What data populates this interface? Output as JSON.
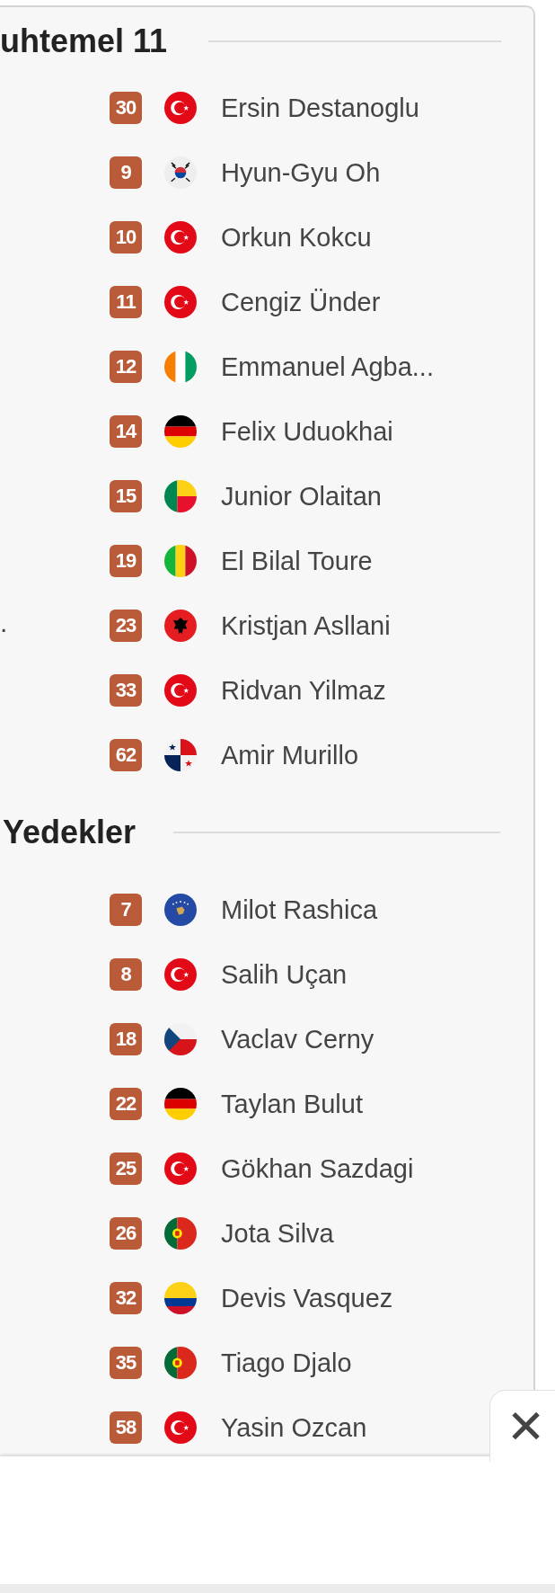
{
  "sections": [
    {
      "title": "uhtemel 11",
      "players": [
        {
          "number": "30",
          "flag": {
            "kind": "tr"
          },
          "name": "Ersin Destanoglu"
        },
        {
          "number": "9",
          "flag": {
            "kind": "kr"
          },
          "name": "Hyun-Gyu Oh"
        },
        {
          "number": "10",
          "flag": {
            "kind": "tr"
          },
          "name": "Orkun Kokcu"
        },
        {
          "number": "11",
          "flag": {
            "kind": "tr"
          },
          "name": "Cengiz Ünder"
        },
        {
          "number": "12",
          "flag": {
            "kind": "ci"
          },
          "name": "Emmanuel Agba..."
        },
        {
          "number": "14",
          "flag": {
            "kind": "de"
          },
          "name": "Felix Uduokhai"
        },
        {
          "number": "15",
          "flag": {
            "kind": "bj"
          },
          "name": "Junior Olaitan"
        },
        {
          "number": "19",
          "flag": {
            "kind": "ml"
          },
          "name": "El Bilal Toure"
        },
        {
          "number": "23",
          "flag": {
            "kind": "al"
          },
          "name": "Kristjan Asllani",
          "left_fragment": "."
        },
        {
          "number": "33",
          "flag": {
            "kind": "tr"
          },
          "name": "Ridvan Yilmaz"
        },
        {
          "number": "62",
          "flag": {
            "kind": "pa"
          },
          "name": "Amir Murillo"
        }
      ]
    },
    {
      "title": "Yedekler",
      "players": [
        {
          "number": "7",
          "flag": {
            "kind": "xk"
          },
          "name": "Milot Rashica"
        },
        {
          "number": "8",
          "flag": {
            "kind": "tr"
          },
          "name": "Salih Uçan"
        },
        {
          "number": "18",
          "flag": {
            "kind": "cz"
          },
          "name": "Vaclav Cerny"
        },
        {
          "number": "22",
          "flag": {
            "kind": "de"
          },
          "name": "Taylan Bulut"
        },
        {
          "number": "25",
          "flag": {
            "kind": "tr"
          },
          "name": "Gökhan Sazdagi"
        },
        {
          "number": "26",
          "flag": {
            "kind": "pt"
          },
          "name": "Jota Silva"
        },
        {
          "number": "32",
          "flag": {
            "kind": "co"
          },
          "name": "Devis Vasquez"
        },
        {
          "number": "35",
          "flag": {
            "kind": "pt"
          },
          "name": "Tiago Djalo"
        },
        {
          "number": "58",
          "flag": {
            "kind": "tr"
          },
          "name": "Yasin Ozcan"
        }
      ]
    }
  ],
  "ad_banner": {
    "close_button": "✕"
  }
}
